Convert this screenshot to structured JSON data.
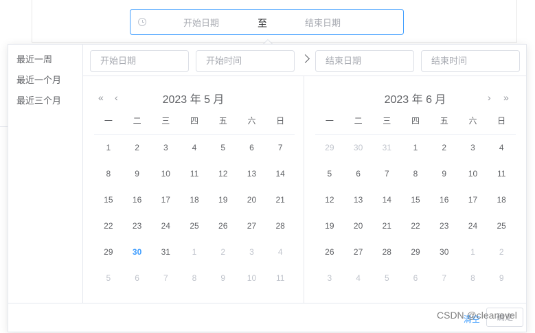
{
  "range": {
    "start_placeholder": "开始日期",
    "separator": "至",
    "end_placeholder": "结束日期",
    "icon": "clock-icon"
  },
  "shortcuts": [
    "最近一周",
    "最近一个月",
    "最近三个月"
  ],
  "header": {
    "start_date": "开始日期",
    "start_time": "开始时间",
    "end_date": "结束日期",
    "end_time": "结束时间"
  },
  "left_month": {
    "title": "2023 年 5 月",
    "prev_year": "«",
    "prev_month": "‹",
    "weekdays": [
      "一",
      "二",
      "三",
      "四",
      "五",
      "六",
      "日"
    ],
    "rows": [
      [
        "1",
        "2",
        "3",
        "4",
        "5",
        "6",
        "7"
      ],
      [
        "8",
        "9",
        "10",
        "11",
        "12",
        "13",
        "14"
      ],
      [
        "15",
        "16",
        "17",
        "18",
        "19",
        "20",
        "21"
      ],
      [
        "22",
        "23",
        "24",
        "25",
        "26",
        "27",
        "28"
      ],
      [
        "29",
        "30",
        "31",
        "1",
        "2",
        "3",
        "4"
      ],
      [
        "5",
        "6",
        "7",
        "8",
        "9",
        "10",
        "11"
      ]
    ],
    "today": "30"
  },
  "right_month": {
    "title": "2023 年 6 月",
    "next_month": "›",
    "next_year": "»",
    "weekdays": [
      "一",
      "二",
      "三",
      "四",
      "五",
      "六",
      "日"
    ],
    "rows": [
      [
        "29",
        "30",
        "31",
        "1",
        "2",
        "3",
        "4"
      ],
      [
        "5",
        "6",
        "7",
        "8",
        "9",
        "10",
        "11"
      ],
      [
        "12",
        "13",
        "14",
        "15",
        "16",
        "17",
        "18"
      ],
      [
        "19",
        "20",
        "21",
        "22",
        "23",
        "24",
        "25"
      ],
      [
        "26",
        "27",
        "28",
        "29",
        "30",
        "1",
        "2"
      ],
      [
        "3",
        "4",
        "5",
        "6",
        "7",
        "8",
        "9"
      ]
    ]
  },
  "footer": {
    "clear": "清空",
    "ok": "确定"
  },
  "watermark": "CSDN @cleanovel",
  "colors": {
    "accent": "#409eff",
    "muted": "#c0c4cc",
    "text": "#606266"
  }
}
